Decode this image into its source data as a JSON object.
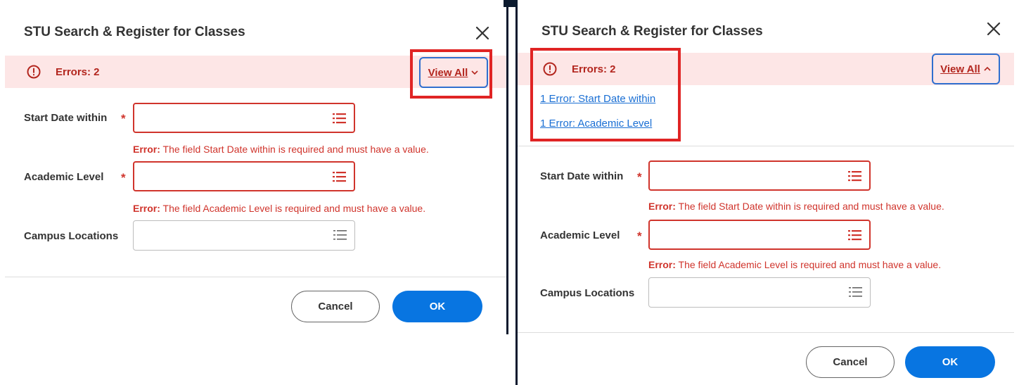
{
  "dialogs": [
    {
      "title": "STU Search & Register for Classes",
      "error_bar": {
        "count_label": "Errors: 2",
        "view_all_label": "View All",
        "expanded": false
      },
      "fields": [
        {
          "label": "Start Date within",
          "required": true,
          "value": "",
          "error_prefix": "Error:",
          "error_text": " The field Start Date within is required and must have a value."
        },
        {
          "label": "Academic Level",
          "required": true,
          "value": "",
          "error_prefix": "Error:",
          "error_text": " The field Academic Level is required and must have a value."
        },
        {
          "label": "Campus Locations",
          "required": false,
          "value": ""
        }
      ],
      "buttons": {
        "cancel": "Cancel",
        "ok": "OK"
      }
    },
    {
      "title": "STU Search & Register for Classes",
      "error_bar": {
        "count_label": "Errors: 2",
        "view_all_label": "View All",
        "expanded": true,
        "links": [
          "1 Error: Start Date within",
          "1 Error: Academic Level"
        ]
      },
      "fields": [
        {
          "label": "Start Date within",
          "required": true,
          "value": "",
          "error_prefix": "Error:",
          "error_text": " The field Start Date within is required and must have a value."
        },
        {
          "label": "Academic Level",
          "required": true,
          "value": "",
          "error_prefix": "Error:",
          "error_text": " The field Academic Level is required and must have a value."
        },
        {
          "label": "Campus Locations",
          "required": false,
          "value": ""
        }
      ],
      "buttons": {
        "cancel": "Cancel",
        "ok": "OK"
      }
    }
  ],
  "icons": {
    "close": "close-icon",
    "error": "alert-circle-icon",
    "list": "list-prompt-icon",
    "chevron_down": "chevron-down-icon",
    "chevron_up": "chevron-up-icon"
  },
  "required_marker": "*",
  "colors": {
    "error": "#d0342c",
    "error_bar_bg": "#fde6e6",
    "primary": "#0875e1",
    "link": "#1a6fd4",
    "highlight": "#e02424"
  }
}
